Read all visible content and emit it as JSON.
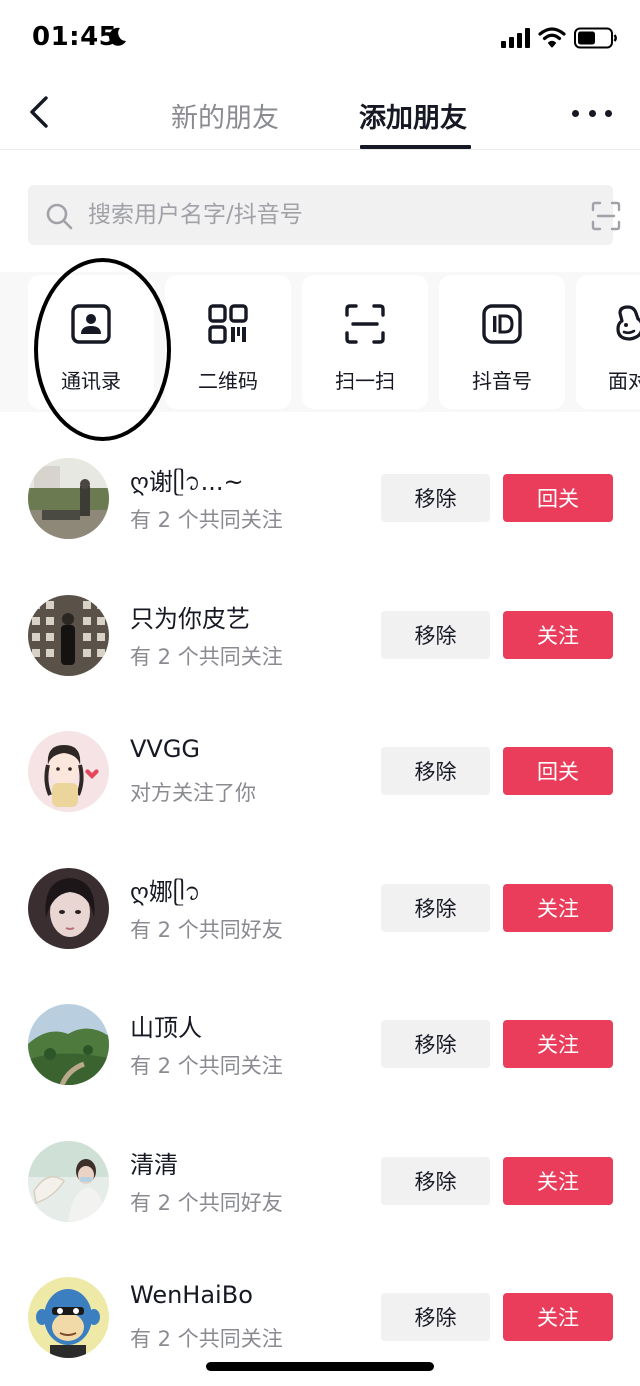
{
  "status_bar": {
    "time": "01:45",
    "icons": [
      "moon-icon",
      "signal-icon",
      "wifi-icon",
      "battery-icon"
    ]
  },
  "nav": {
    "tabs": [
      {
        "label": "新的朋友",
        "active": false
      },
      {
        "label": "添加朋友",
        "active": true
      }
    ],
    "icons": [
      "back-icon",
      "more-icon"
    ]
  },
  "search": {
    "placeholder": "搜索用户名字/抖音号",
    "icons": [
      "search-icon",
      "scan-icon"
    ]
  },
  "quick_actions": [
    {
      "label": "通讯录",
      "icon": "contacts-icon"
    },
    {
      "label": "二维码",
      "icon": "qr-code-icon"
    },
    {
      "label": "扫一扫",
      "icon": "scan-icon"
    },
    {
      "label": "抖音号",
      "icon": "id-icon"
    },
    {
      "label": "面对",
      "icon": "face-to-face-icon"
    }
  ],
  "friends": [
    {
      "name": "ღ谢ᥫ᭡...~",
      "sub": "有 2 个共同关注",
      "remove": "移除",
      "action": "回关"
    },
    {
      "name": "只为你皮艺",
      "sub": "有 2 个共同关注",
      "remove": "移除",
      "action": "关注"
    },
    {
      "name": "VVGG",
      "sub": "对方关注了你",
      "remove": "移除",
      "action": "回关"
    },
    {
      "name": "ღ娜ᥫ᭡",
      "sub": "有 2 个共同好友",
      "remove": "移除",
      "action": "关注"
    },
    {
      "name": "山顶人",
      "sub": "有 2 个共同关注",
      "remove": "移除",
      "action": "关注"
    },
    {
      "name": "清清",
      "sub": "有 2 个共同好友",
      "remove": "移除",
      "action": "关注"
    },
    {
      "name": "WenHaiBo",
      "sub": "有 2 个共同关注",
      "remove": "移除",
      "action": "关注"
    }
  ],
  "colors": {
    "accent": "#ea3d5c",
    "text_primary": "#161823",
    "text_secondary": "#8a8b91",
    "surface": "#f1f1f2"
  }
}
